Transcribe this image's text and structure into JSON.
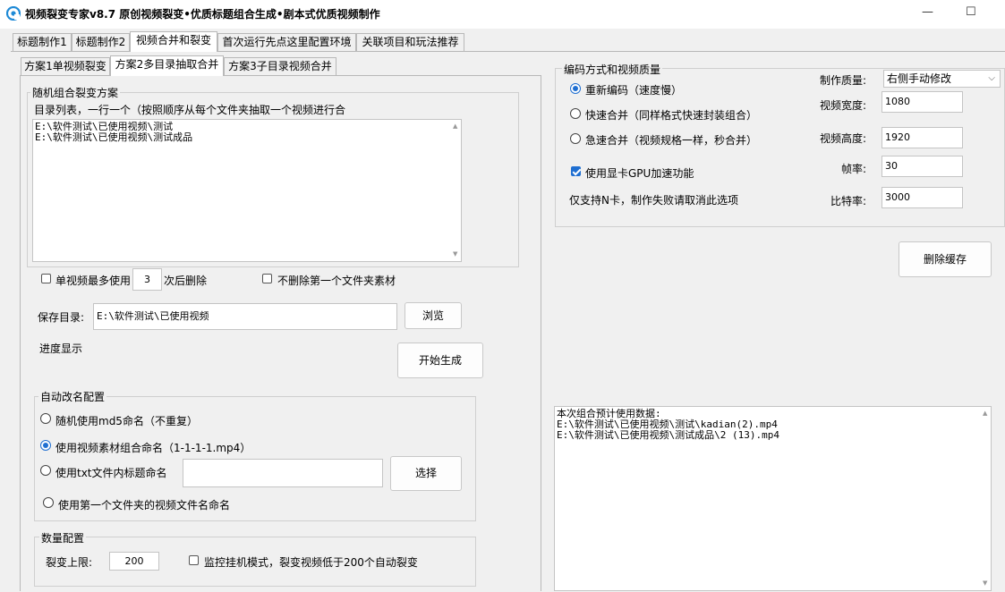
{
  "window": {
    "title": "视频裂变专家v8.7    原创视频裂变•优质标题组合生成•剧本式优质视频制作",
    "minimize": "—",
    "maximize": "☐"
  },
  "main_tabs": [
    "标题制作1",
    "标题制作2",
    "视频合并和裂变",
    "首次运行先点这里配置环境",
    "关联项目和玩法推荐"
  ],
  "sub_tabs": [
    "方案1单视频裂变",
    "方案2多目录抽取合并",
    "方案3子目录视频合并"
  ],
  "random_group": {
    "title": "随机组合裂变方案",
    "dir_hint": "目录列表，一行一个（按照顺序从每个文件夹抽取一个视频进行合",
    "dir_list": "E:\\软件测试\\已使用视频\\测试\nE:\\软件测试\\已使用视频\\测试成品"
  },
  "options": {
    "max_use_label": "单视频最多使用",
    "max_use_value": "3",
    "max_use_suffix": "次后删除",
    "no_delete_first_label": "不删除第一个文件夹素材"
  },
  "save": {
    "label": "保存目录:",
    "path": "E:\\软件测试\\已使用视频",
    "browse": "浏览"
  },
  "progress_label": "进度显示",
  "start_button": "开始生成",
  "rename": {
    "title": "自动改名配置",
    "opt1": "随机使用md5命名（不重复）",
    "opt2": "使用视频素材组合命名（1-1-1-1.mp4）",
    "opt3": "使用txt文件内标题命名",
    "opt3_value": "",
    "select_button": "选择",
    "opt4": "使用第一个文件夹的视频文件名命名"
  },
  "quantity": {
    "title": "数量配置",
    "limit_label": "裂变上限:",
    "limit_value": "200",
    "monitor_label": "监控挂机模式，裂变视频低于200个自动裂变"
  },
  "encoding": {
    "title": "编码方式和视频质量",
    "re_encode": "重新编码（速度慢）",
    "fast_merge": "快速合并（同样格式快速封装组合）",
    "ultra_merge": "急速合并（视频规格一样，秒合并）",
    "gpu_label": "使用显卡GPU加速功能",
    "nvidia_note": "仅支持N卡，制作失败请取消此选项",
    "quality_label": "制作质量:",
    "quality_value": "右侧手动修改",
    "width_label": "视频宽度:",
    "width_value": "1080",
    "height_label": "视频高度:",
    "height_value": "1920",
    "fps_label": "帧率:",
    "fps_value": "30",
    "bitrate_label": "比特率:",
    "bitrate_value": "3000"
  },
  "clear_cache_button": "删除缓存",
  "log": "本次组合预计使用数据:\nE:\\软件测试\\已使用视频\\测试\\kadian(2).mp4\nE:\\软件测试\\已使用视频\\测试成品\\2 (13).mp4",
  "colors": {
    "accent": "#1f6fd1",
    "panel": "#f0f0f0",
    "white": "#ffffff"
  }
}
